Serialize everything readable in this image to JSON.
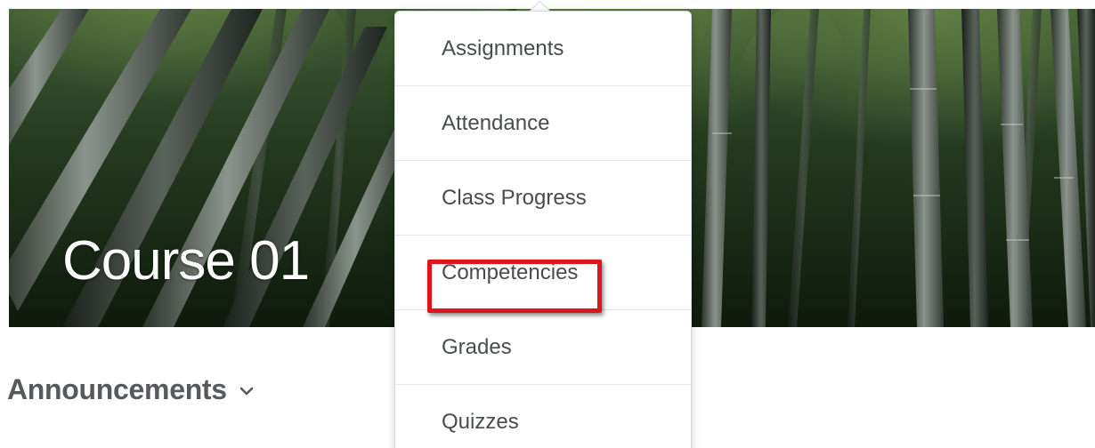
{
  "banner": {
    "title": "Course 01",
    "image": "bamboo-forest-image"
  },
  "announcements": {
    "title": "Announcements",
    "toggle_icon": "chevron-down-icon"
  },
  "menu": {
    "items": [
      {
        "label": "Assignments"
      },
      {
        "label": "Attendance"
      },
      {
        "label": "Class Progress"
      },
      {
        "label": "Competencies",
        "highlighted": true
      },
      {
        "label": "Grades"
      },
      {
        "label": "Quizzes"
      }
    ]
  },
  "colors": {
    "highlight_border": "#e0141b",
    "menu_text": "#494c4e",
    "heading_text": "#565a5c",
    "menu_border": "#d3d9e3"
  }
}
